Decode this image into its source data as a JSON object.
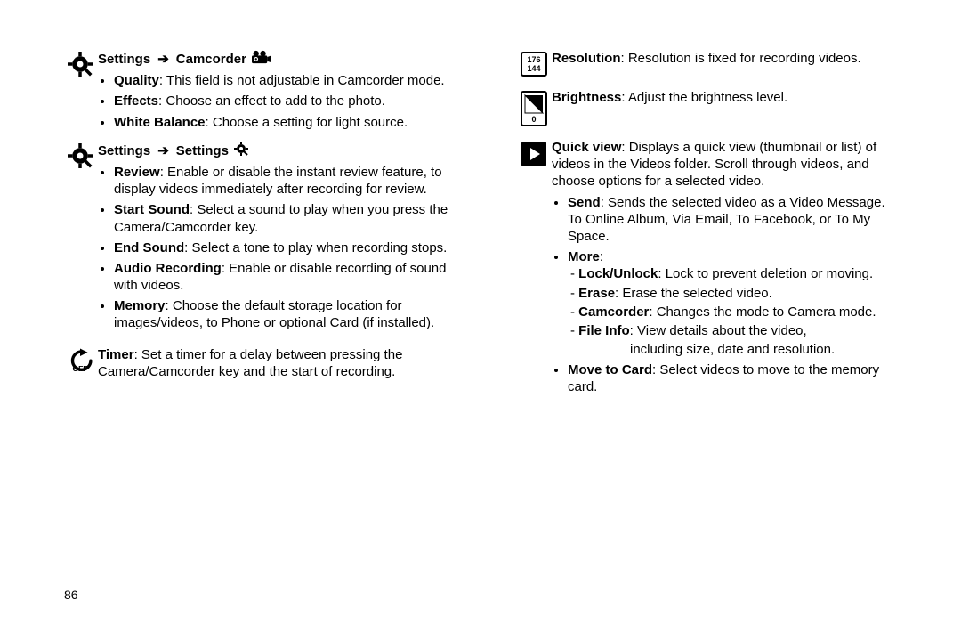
{
  "page_number": "86",
  "left": {
    "sec1": {
      "heading_a": "Settings",
      "heading_arrow": "➔",
      "heading_b": "Camcorder",
      "items": {
        "quality_lbl": "Quality",
        "quality_txt": ": This field is not adjustable in Camcorder mode.",
        "effects_lbl": "Effects",
        "effects_txt": ": Choose an effect to add to the photo.",
        "wb_lbl": "White Balance",
        "wb_txt": ": Choose a setting for light source."
      }
    },
    "sec2": {
      "heading_a": "Settings",
      "heading_arrow": "➔",
      "heading_b": "Settings",
      "items": {
        "review_lbl": "Review",
        "review_txt": ": Enable or disable the instant review feature, to display videos immediately after recording for review.",
        "start_lbl": "Start Sound",
        "start_txt": ": Select a sound to play when you press the Camera/Camcorder key.",
        "end_lbl": "End Sound",
        "end_txt": ": Select a tone to play when recording stops.",
        "audio_lbl": "Audio Recording",
        "audio_txt": ": Enable or disable recording of sound with videos.",
        "mem_lbl": "Memory",
        "mem_txt": ": Choose the default storage location for images/videos, to Phone or optional Card (if installed)."
      }
    },
    "timer": {
      "lbl": "Timer",
      "txt": ": Set a timer for a delay between pressing the Camera/Camcorder key and the start of recording."
    }
  },
  "right": {
    "resolution": {
      "badge_top": "176",
      "badge_bot": "144",
      "lbl": "Resolution",
      "txt": ": Resolution is fixed for recording videos."
    },
    "brightness": {
      "badge_zero": "0",
      "lbl": "Brightness",
      "txt": ": Adjust the brightness level."
    },
    "quickview": {
      "lbl": "Quick view",
      "txt": ": Displays a quick view (thumbnail or list) of videos in the Videos folder. Scroll through videos, and choose options for a selected video.",
      "send_lbl": "Send",
      "send_txt": ": Sends the selected video as a Video Message. To Online Album, Via Email, To Facebook, or To My Space.",
      "more_lbl": "More",
      "more_colon": ":",
      "lock_lbl": "Lock/Unlock",
      "lock_txt": ": Lock to prevent deletion or moving.",
      "erase_lbl": "Erase",
      "erase_txt": ": Erase the selected video.",
      "cam_lbl": "Camcorder",
      "cam_txt": ": Changes the mode to Camera mode.",
      "file_lbl": "File Info",
      "file_txt": ": View details about the video,",
      "file_txt2": "including size, date and resolution.",
      "move_lbl": "Move to Card",
      "move_txt": ": Select videos to move to the memory card."
    }
  }
}
